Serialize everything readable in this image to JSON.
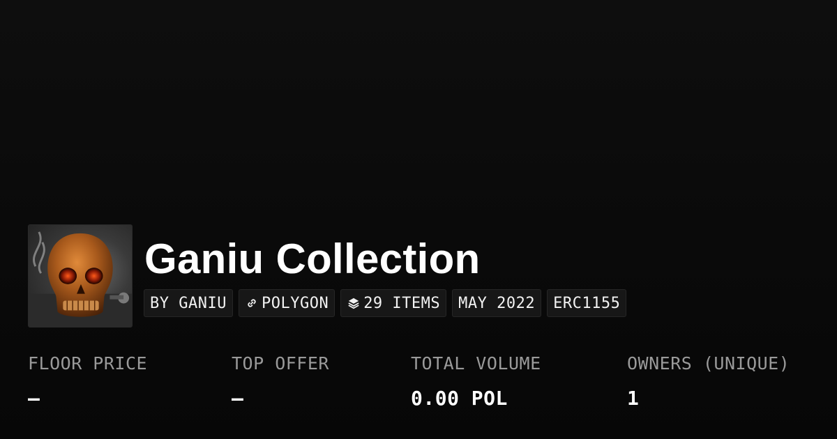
{
  "collection": {
    "title": "Ganiu Collection",
    "avatar_icon": "skull-avatar",
    "chips": [
      {
        "label": "BY GANIU",
        "icon": ""
      },
      {
        "label": "POLYGON",
        "icon": "link-icon"
      },
      {
        "label": "29 ITEMS",
        "icon": "layers-icon"
      },
      {
        "label": "MAY 2022",
        "icon": ""
      },
      {
        "label": "ERC1155",
        "icon": ""
      }
    ]
  },
  "stats": [
    {
      "label": "FLOOR PRICE",
      "value": "–"
    },
    {
      "label": "TOP OFFER",
      "value": "–"
    },
    {
      "label": "TOTAL VOLUME",
      "value": "0.00 POL"
    },
    {
      "label": "OWNERS (UNIQUE)",
      "value": "1"
    }
  ],
  "colors": {
    "background": "#0a0a0a",
    "chip_background": "#171717",
    "label_gray": "#9a9a9a",
    "text_white": "#ffffff"
  }
}
